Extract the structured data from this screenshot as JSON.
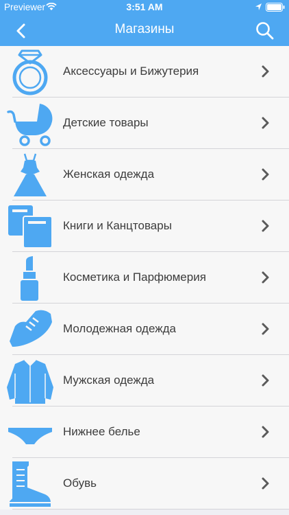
{
  "status_bar": {
    "carrier": "Previewer",
    "time": "3:51 AM"
  },
  "nav": {
    "title": "Магазины",
    "back_icon": "chevron-left-icon",
    "search_icon": "search-icon"
  },
  "colors": {
    "accent": "#4ea8f2",
    "icon": "#4ea8f2",
    "chevron": "#5a5a5a"
  },
  "categories": [
    {
      "label": "Аксессуары и Бижутерия",
      "icon": "ring-icon"
    },
    {
      "label": "Детские товары",
      "icon": "stroller-icon"
    },
    {
      "label": "Женская одежда",
      "icon": "dress-icon"
    },
    {
      "label": "Книги и Канцтовары",
      "icon": "books-icon"
    },
    {
      "label": "Косметика и Парфюмерия",
      "icon": "lipstick-icon"
    },
    {
      "label": "Молодежная одежда",
      "icon": "sneaker-icon"
    },
    {
      "label": "Мужская одежда",
      "icon": "shirt-icon"
    },
    {
      "label": "Нижнее белье",
      "icon": "underwear-icon"
    },
    {
      "label": "Обувь",
      "icon": "boot-icon"
    }
  ]
}
